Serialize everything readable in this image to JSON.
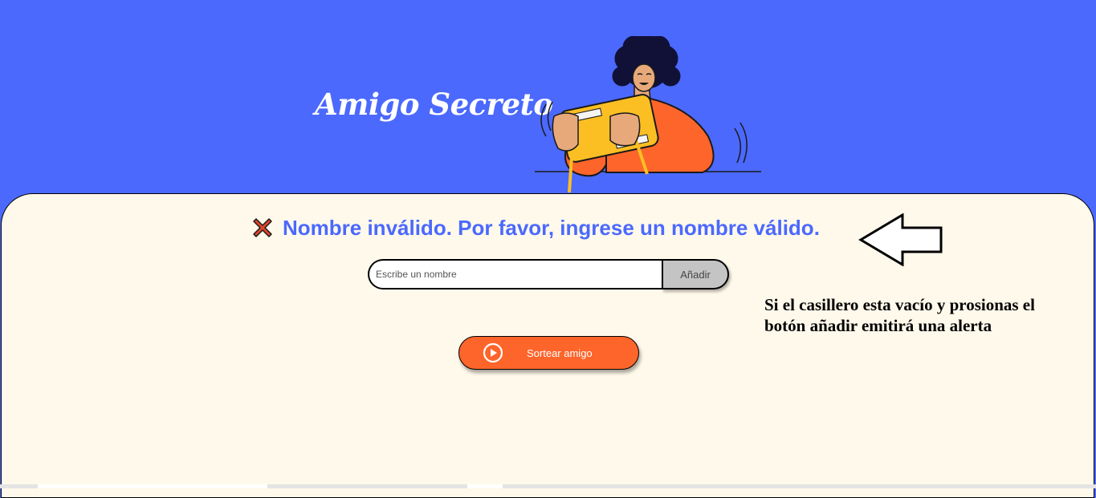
{
  "header": {
    "title": "Amigo Secreto",
    "illustration": "person-playing-handheld-console"
  },
  "alert": {
    "icon": "x-mark-icon",
    "message": "Nombre inválido. Por favor, ingrese un nombre válido."
  },
  "form": {
    "input_placeholder": "Escribe un nombre",
    "input_value": "",
    "add_label": "Añadir"
  },
  "draw": {
    "label": "Sortear amigo",
    "icon": "play-circle-icon"
  },
  "annotation": {
    "arrow_icon": "left-arrow-icon",
    "line1": "Si el casillero esta vacío y prosionas el",
    "line2": "botón añadir emitirá una alerta"
  },
  "colors": {
    "header_bg": "#4b69fd",
    "content_bg": "#fff9eb",
    "accent_text": "#4b69fd",
    "primary_button": "#fe652b",
    "add_button": "#c4c4c4",
    "error_icon": "#e0452a"
  }
}
